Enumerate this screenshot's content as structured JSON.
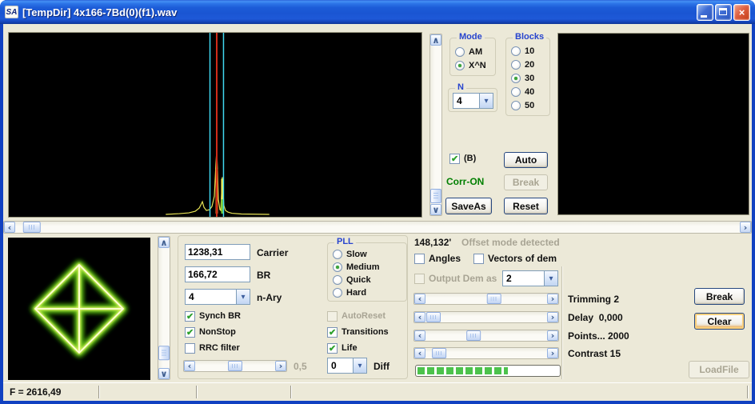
{
  "window": {
    "title": "[TempDir] 4x166-7Bd(0)(f1).wav",
    "icon_text": "SA",
    "close_glyph": "×"
  },
  "top": {
    "mode": {
      "label": "Mode",
      "options": [
        {
          "label": "AM",
          "selected": false
        },
        {
          "label": "X^N",
          "selected": true
        }
      ]
    },
    "n": {
      "label": "N",
      "value": "4"
    },
    "blocks": {
      "label": "Blocks",
      "options": [
        {
          "label": "10",
          "selected": false
        },
        {
          "label": "20",
          "selected": false
        },
        {
          "label": "30",
          "selected": true
        },
        {
          "label": "40",
          "selected": false
        },
        {
          "label": "50",
          "selected": false
        }
      ]
    },
    "b_check": {
      "label": "(B)",
      "checked": true
    },
    "auto_btn": "Auto",
    "corr_status": "Corr-ON",
    "break_btn": "Break",
    "saveas_btn": "SaveAs",
    "reset_btn": "Reset"
  },
  "demod": {
    "carrier": {
      "value": "1238,31",
      "label": "Carrier"
    },
    "br": {
      "value": "166,72",
      "label": "BR"
    },
    "nary": {
      "value": "4",
      "label": "n-Ary"
    },
    "synch_br": {
      "label": "Synch BR",
      "checked": true
    },
    "nonstop": {
      "label": "NonStop",
      "checked": true
    },
    "rrc": {
      "label": "RRC filter",
      "checked": false
    },
    "rrc_slider": {
      "value_label": "0,5",
      "thumb_pct": 50
    },
    "pll": {
      "label": "PLL",
      "options": [
        {
          "label": "Slow",
          "selected": false
        },
        {
          "label": "Medium",
          "selected": true
        },
        {
          "label": "Quick",
          "selected": false
        },
        {
          "label": "Hard",
          "selected": false
        }
      ]
    },
    "autoreset": {
      "label": "AutoReset",
      "checked": false
    },
    "transitions": {
      "label": "Transitions",
      "checked": true
    },
    "life": {
      "label": "Life",
      "checked": true
    },
    "diff": {
      "value": "0",
      "label": "Diff"
    }
  },
  "analysis": {
    "freq_value": "148,132'",
    "status_text": "Offset mode detected",
    "angles": {
      "label": "Angles",
      "checked": false
    },
    "vectors": {
      "label": "Vectors of dem",
      "checked": false
    },
    "output_dem": {
      "label": "Output Dem as",
      "checked": false,
      "value": "2"
    },
    "sliders": [
      {
        "label": "Trimming 2",
        "thumb_pct": 57
      },
      {
        "label": "Delay  0,000",
        "thumb_pct": 0
      },
      {
        "label": "Points... 2000",
        "thumb_pct": 38
      },
      {
        "label": "Contrast 15",
        "thumb_pct": 5
      }
    ],
    "progress_pct": 64,
    "break_btn": "Break",
    "clear_btn": "Clear",
    "loadfile_btn": "LoadFile"
  },
  "scrollbars": {
    "top_v_thumb_pct": 100,
    "bottom_v_thumb_pct": 93,
    "main_h_thumb_pct": 1
  },
  "statusbar": {
    "f_value": "F = 2616,49"
  },
  "colors": {
    "corr_green": "#007F00",
    "disabled_text": "#A8A494",
    "marker_cyan": "#40D8F0",
    "marker_red": "#D22B18",
    "trace_yellow": "#E8E455",
    "constellation_glow": "#7FD420",
    "progress_green": "#4CC24C"
  }
}
